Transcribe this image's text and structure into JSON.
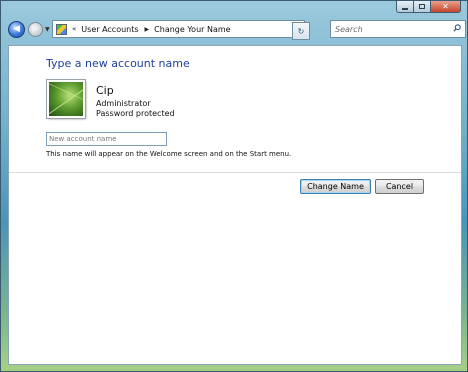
{
  "window": {
    "buttons": {
      "minimize": "minimize",
      "maximize": "maximize",
      "close": "close"
    }
  },
  "nav": {
    "back_icon": "back-arrow-icon",
    "forward_icon": "forward-arrow-icon",
    "breadcrumbs": [
      "User Accounts",
      "Change Your Name"
    ],
    "search_placeholder": "Search"
  },
  "main": {
    "heading": "Type a new account name",
    "user": {
      "name": "Cip",
      "role": "Administrator",
      "protection": "Password protected"
    },
    "new_name_placeholder": "New account name",
    "help_text": "This name will appear on the Welcome screen and on the Start menu.",
    "change_button": "Change Name",
    "cancel_button": "Cancel"
  },
  "colors": {
    "heading": "#1e3f9a",
    "window_frame": "#6fb0cb"
  }
}
